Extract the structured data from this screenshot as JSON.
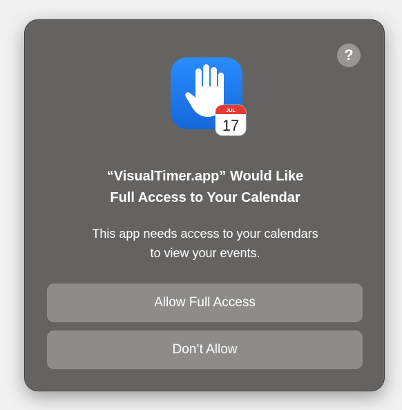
{
  "dialog": {
    "help_label": "?",
    "icon": {
      "app_icon": "hand-raised-icon",
      "badge_icon": "calendar-icon",
      "badge_day": "17",
      "badge_month": "JUL",
      "colors": {
        "tile": "#1f7cf2",
        "badge_header": "#e63b32"
      }
    },
    "title_line1": "“VisualTimer.app” Would Like",
    "title_line2": "Full Access to Your Calendar",
    "message_line1": "This app needs access to your calendars",
    "message_line2": "to view your events.",
    "allow_button_label": "Allow Full Access",
    "deny_button_label": "Don’t Allow"
  }
}
